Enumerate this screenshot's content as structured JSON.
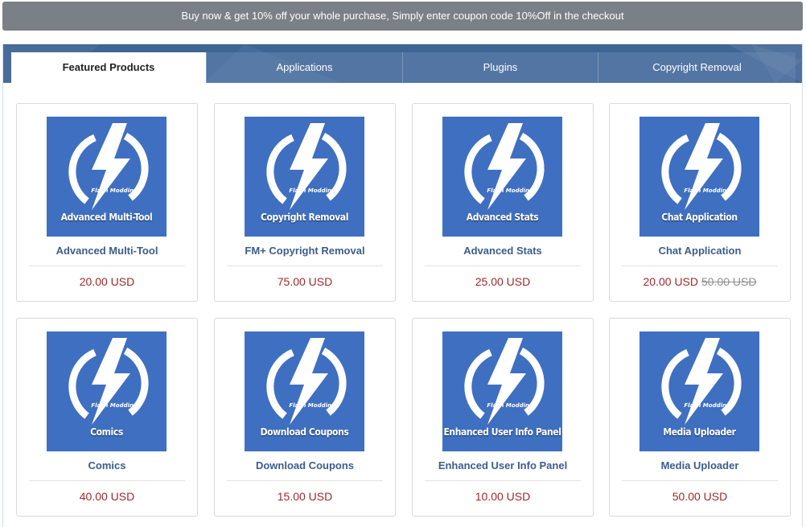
{
  "banner": {
    "text": "Buy now & get 10% off your whole purchase, Simply enter coupon code 10%Off in the checkout"
  },
  "tabs": [
    {
      "label": "Featured Products",
      "active": true
    },
    {
      "label": "Applications",
      "active": false
    },
    {
      "label": "Plugins",
      "active": false
    },
    {
      "label": "Copyright Removal",
      "active": false
    }
  ],
  "colors": {
    "accent": "#3f6595",
    "thumb_bg": "#3f6fc1",
    "price": "#a0292b",
    "title": "#3c5d8c"
  },
  "products": [
    {
      "icon": "lightning-bolt-icon",
      "brand": "Flash Modding",
      "caption": "Advanced Multi-Tool",
      "title": "Advanced Multi-Tool",
      "price": "20.00 USD",
      "old_price": ""
    },
    {
      "icon": "lightning-bolt-icon",
      "brand": "Flash Modding",
      "caption": "Copyright Removal",
      "title": "FM+ Copyright Removal",
      "price": "75.00 USD",
      "old_price": ""
    },
    {
      "icon": "lightning-bolt-icon",
      "brand": "Flash Modding",
      "caption": "Advanced Stats",
      "title": "Advanced Stats",
      "price": "25.00 USD",
      "old_price": ""
    },
    {
      "icon": "lightning-bolt-icon",
      "brand": "Flash Modding",
      "caption": "Chat Application",
      "title": "Chat Application",
      "price": "20.00 USD",
      "old_price": "50.00 USD"
    },
    {
      "icon": "lightning-bolt-icon",
      "brand": "Flash Modding",
      "caption": "Comics",
      "title": "Comics",
      "price": "40.00 USD",
      "old_price": ""
    },
    {
      "icon": "lightning-bolt-icon",
      "brand": "Flash Modding",
      "caption": "Download Coupons",
      "title": "Download Coupons",
      "price": "15.00 USD",
      "old_price": ""
    },
    {
      "icon": "lightning-bolt-icon",
      "brand": "Flash Modding",
      "caption": "Enhanced User Info Panel",
      "title": "Enhanced User Info Panel",
      "price": "10.00 USD",
      "old_price": ""
    },
    {
      "icon": "lightning-bolt-icon",
      "brand": "Flash Modding",
      "caption": "Media Uploader",
      "title": "Media Uploader",
      "price": "50.00 USD",
      "old_price": ""
    }
  ]
}
